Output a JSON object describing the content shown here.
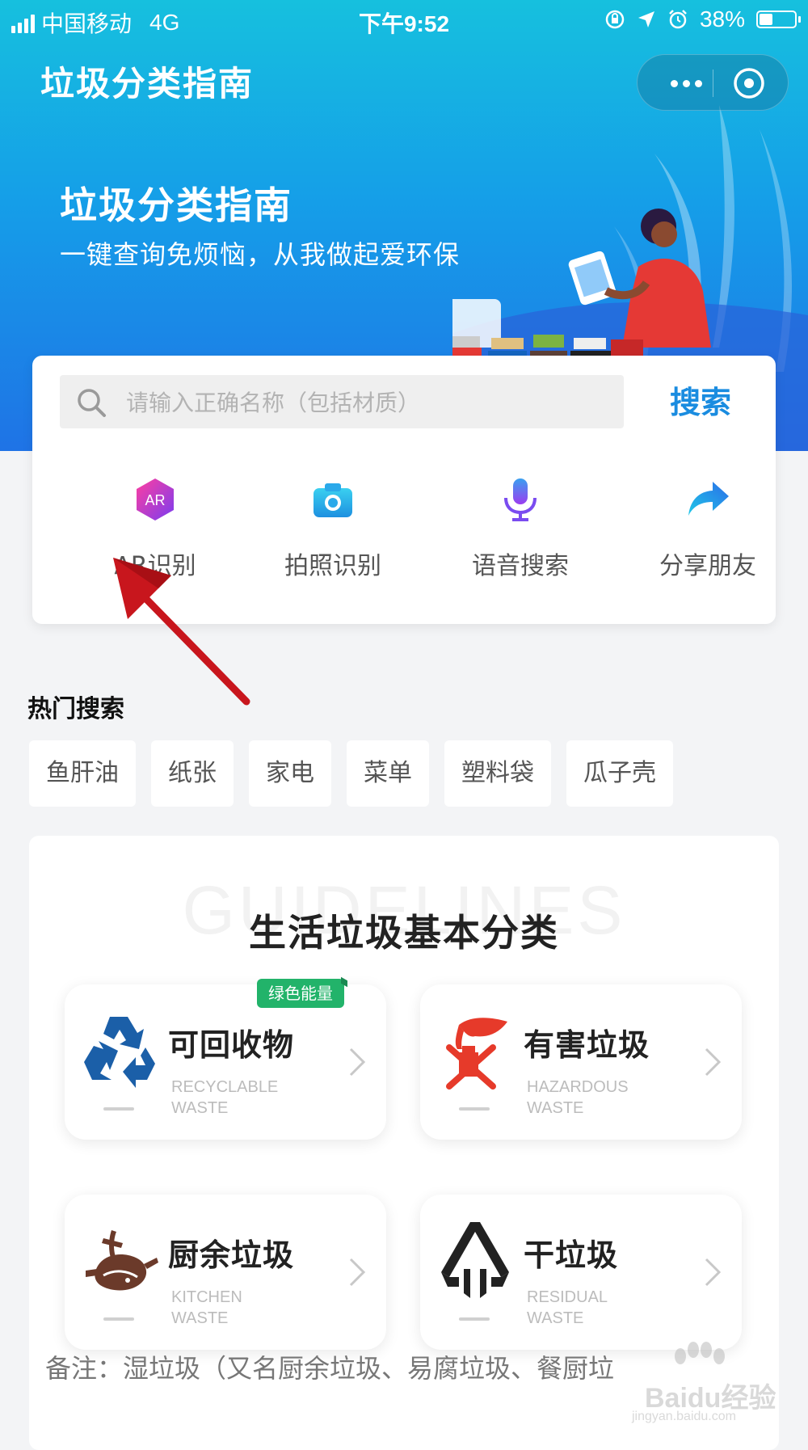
{
  "status_bar": {
    "carrier": "中国移动",
    "network": "4G",
    "time": "下午9:52",
    "battery_percent": "38%",
    "battery_level": 0.38,
    "icons": [
      "rotation-lock-icon",
      "location-arrow-icon",
      "alarm-icon",
      "battery-icon",
      "signal-icon"
    ]
  },
  "nav": {
    "title": "垃圾分类指南",
    "more_icon": "more-dots-icon",
    "close_icon": "close-target-icon"
  },
  "banner": {
    "title": "垃圾分类指南",
    "subtitle": "一键查询免烦恼，从我做起爱环保"
  },
  "search": {
    "placeholder": "请输入正确名称（包括材质）",
    "value": "",
    "button_label": "搜索",
    "icon": "search-icon"
  },
  "quick_actions": [
    {
      "label": "AR识别",
      "icon": "ar-icon",
      "color": "#b33df0"
    },
    {
      "label": "拍照识别",
      "icon": "camera-icon",
      "color": "#29a8e8"
    },
    {
      "label": "语音搜索",
      "icon": "microphone-icon",
      "color": "#9a4cf0"
    },
    {
      "label": "分享朋友",
      "icon": "share-arrow-icon",
      "color": "#2b8ae8"
    }
  ],
  "hot_search": {
    "title": "热门搜索",
    "tags": [
      "鱼肝油",
      "纸张",
      "家电",
      "菜单",
      "塑料袋",
      "瓜子壳"
    ]
  },
  "guide": {
    "watermark": "GUIDELINES",
    "title": "生活垃圾基本分类",
    "categories": [
      {
        "name": "可回收物",
        "en_line1": "RECYCLABLE",
        "en_line2": "WASTE",
        "icon": "recycle-icon",
        "badge": "绿色能量",
        "color": "#1b5fa8"
      },
      {
        "name": "有害垃圾",
        "en_line1": "HAZARDOUS",
        "en_line2": "WASTE",
        "icon": "hazardous-battery-icon",
        "color": "#e63a2a"
      },
      {
        "name": "厨余垃圾",
        "en_line1": "KITCHEN",
        "en_line2": "WASTE",
        "icon": "kitchen-waste-icon",
        "color": "#6b3a2a"
      },
      {
        "name": "干垃圾",
        "en_line1": "RESIDUAL",
        "en_line2": "WASTE",
        "icon": "residual-waste-icon",
        "color": "#222222"
      }
    ],
    "note": "备注：湿垃圾（又名厨余垃圾、易腐垃圾、餐厨垃"
  },
  "watermark": {
    "text": "Baidu经验",
    "url": "jingyan.baidu.com"
  },
  "annotation_arrow": {
    "color": "#c8161d",
    "target": "AR识别"
  }
}
